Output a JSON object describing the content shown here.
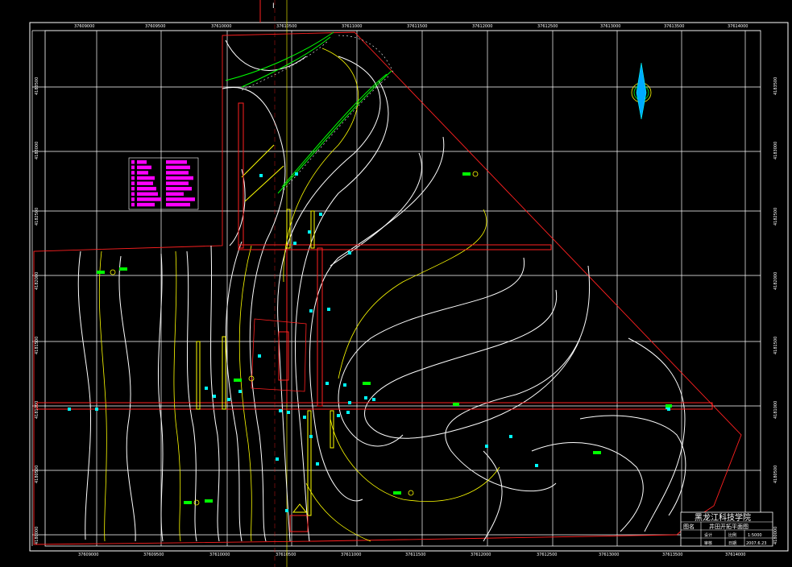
{
  "section_marker": "I",
  "title_block": {
    "institution": "黑龙江科技学院",
    "drawing_title_label": "图名",
    "drawing_title": "井田开拓平面图",
    "scale_label": "比例",
    "scale": "1:5000",
    "date_label": "日期",
    "date": "2007.6.23",
    "designer_label": "设计",
    "checker_label": "审核"
  },
  "grid_labels_top": [
    "37609000",
    "37609500",
    "37610000",
    "37610500",
    "37611000",
    "37611500",
    "37612000",
    "37612500",
    "37613000",
    "37613500",
    "37614000"
  ],
  "grid_labels_bottom": [
    "37609000",
    "37609500",
    "37610000",
    "37610500",
    "37611000",
    "37611500",
    "37612000",
    "37612500",
    "37613000",
    "37613500",
    "37614000"
  ],
  "grid_labels_left": [
    "4183500",
    "4183000",
    "4182500",
    "4182000",
    "4181500",
    "4181000",
    "4180500",
    "4180000"
  ],
  "grid_labels_right": [
    "4183500",
    "4183000",
    "4182500",
    "4182000",
    "4181500",
    "4181000",
    "4180500",
    "4180000"
  ],
  "colors": {
    "background": "#000000",
    "grid": "#ffffff",
    "boundary": "#ff2020",
    "contour": "#ffffff",
    "contour_index": "#ffff00",
    "roadway": "#ff2020",
    "seam": "#00ff00",
    "marker": "#00ffff",
    "legend": "#ff00ff",
    "north": "#00ffff"
  }
}
